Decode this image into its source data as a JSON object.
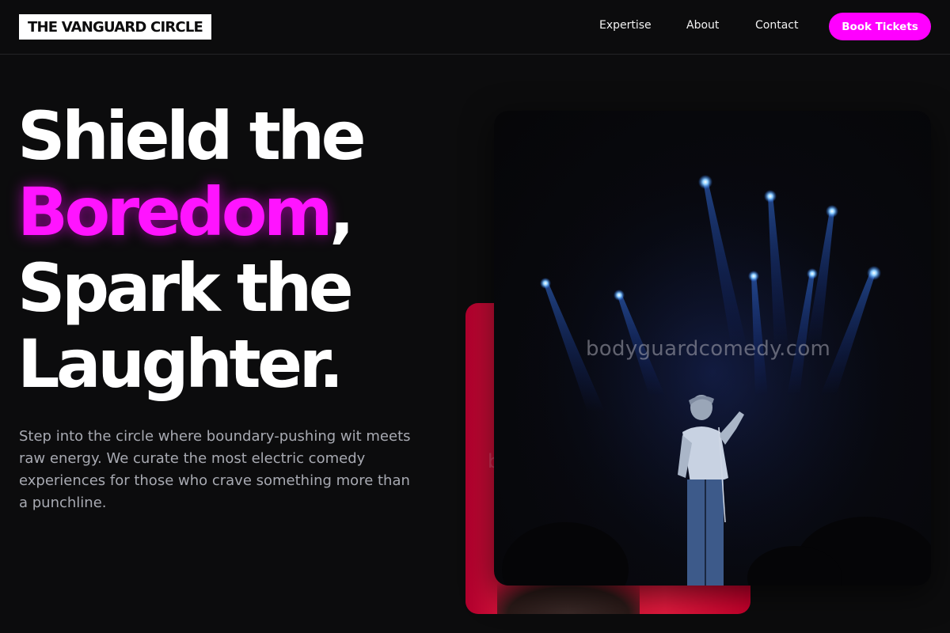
{
  "nav": {
    "logo": "THE VANGUARD CIRCLE",
    "links": [
      "Expertise",
      "About",
      "Contact"
    ],
    "cta": "Book Tickets"
  },
  "hero": {
    "line1": "Shield the",
    "accent": "Boredom",
    "comma": ",",
    "line3": "Spark the",
    "line4": "Laughter.",
    "lede": "Step into the circle where boundary-pushing wit meets raw energy. We curate the most electric comedy experiences for those who crave something more than a punchline."
  },
  "watermark": "bodyguardcomedy.com",
  "colors": {
    "accent": "#ff00ff",
    "background": "#0c0c0d",
    "back_card": "#d4123a",
    "muted_text": "#a8aab2"
  }
}
